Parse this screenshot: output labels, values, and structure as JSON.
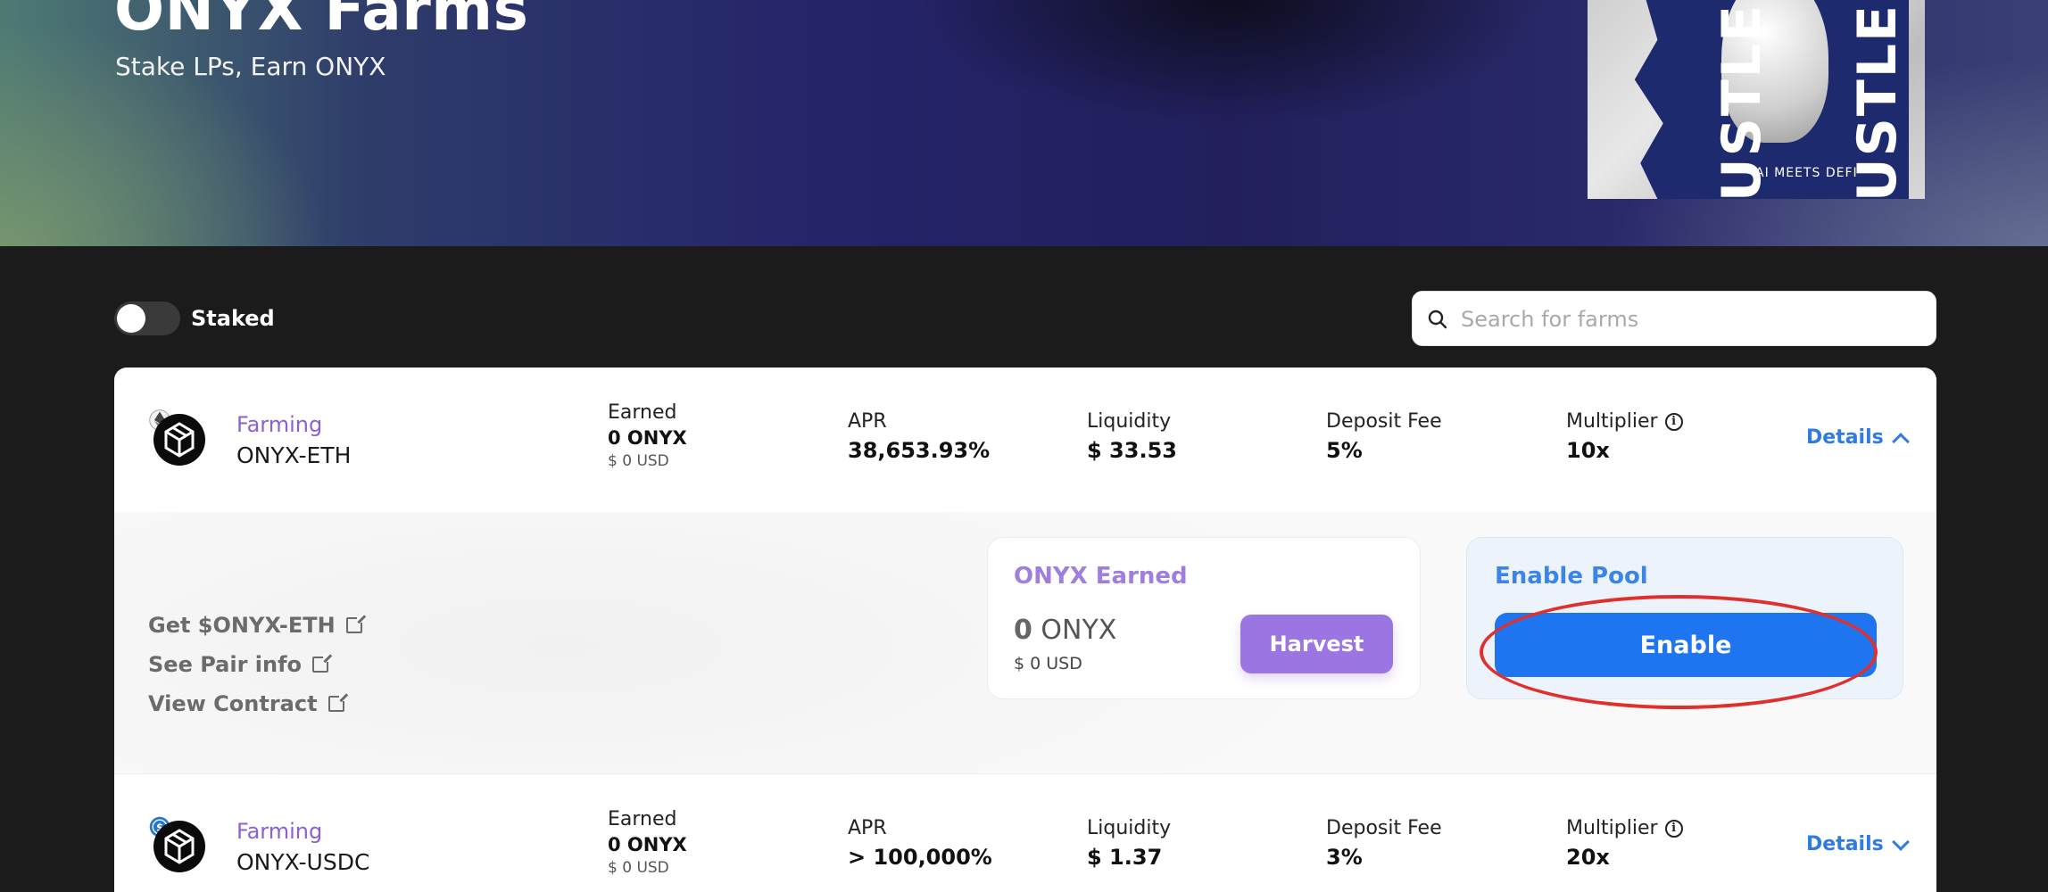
{
  "hero": {
    "title": "ONYX Farms",
    "subtitle": "Stake LPs, Earn ONYX",
    "poster": {
      "word_left": "TRUSTLE",
      "word_right": "TRUSTLE",
      "tagline": "AI MEETS DEFI"
    }
  },
  "toolbar": {
    "staked_label": "Staked",
    "staked_on": false,
    "search_placeholder": "Search for farms",
    "search_value": ""
  },
  "farms": [
    {
      "tag": "Farming",
      "name": "ONYX-ETH",
      "token_icon": "eth-token-icon",
      "earned_label": "Earned",
      "earned": "0 ONYX",
      "earned_usd": "$ 0 USD",
      "apr_label": "APR",
      "apr": "38,653.93%",
      "liquidity_label": "Liquidity",
      "liquidity": "$ 33.53",
      "fee_label": "Deposit Fee",
      "fee": "5%",
      "multiplier_label": "Multiplier",
      "multiplier": "10x",
      "details_label": "Details",
      "expanded": true
    },
    {
      "tag": "Farming",
      "name": "ONYX-USDC",
      "token_icon": "usdc-token-icon",
      "earned_label": "Earned",
      "earned": "0 ONYX",
      "earned_usd": "$ 0 USD",
      "apr_label": "APR",
      "apr": "> 100,000%",
      "liquidity_label": "Liquidity",
      "liquidity": "$ 1.37",
      "fee_label": "Deposit Fee",
      "fee": "3%",
      "multiplier_label": "Multiplier",
      "multiplier": "20x",
      "details_label": "Details",
      "expanded": false
    }
  ],
  "expanded": {
    "links": [
      "Get $ONYX-ETH",
      "See Pair info",
      "View Contract"
    ],
    "earned_title": "ONYX Earned",
    "earned_amount": "0",
    "earned_unit": "ONYX",
    "earned_usd": "$ 0 USD",
    "harvest_label": "Harvest",
    "pool_title": "Enable Pool",
    "enable_label": "Enable"
  },
  "colors": {
    "accent_purple": "#9b76e3",
    "accent_blue": "#1f75f0",
    "annotation_red": "#e0302e"
  },
  "icons": [
    "search-icon",
    "info-icon",
    "chevron-up-icon",
    "chevron-down-icon",
    "external-link-icon",
    "onyx-token-icon",
    "eth-token-icon",
    "usdc-token-icon"
  ]
}
